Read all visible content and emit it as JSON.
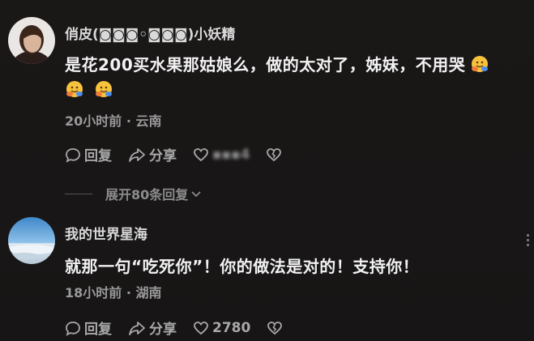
{
  "top_partial_text": "▂▂▂▂▂▂ ▂▂▂▂",
  "comments": [
    {
      "author": "俏皮(◙◙◙◦◙◙◙)小妖精",
      "text": "是花200买水果那姑娘么，做的太对了，姊妹，不用哭",
      "emoji_count": 3,
      "meta": "20小时前 · 云南",
      "reply_label": "回复",
      "share_label": "分享",
      "like_count": "▪▪▪4",
      "expand_label": "展开80条回复"
    },
    {
      "author": "我的世界星海",
      "text": "就那一句“吃死你”！你的做法是对的！支持你！",
      "meta": "18小时前 · 湖南",
      "reply_label": "回复",
      "share_label": "分享",
      "like_count": "2780"
    }
  ],
  "icons": {
    "reply": "speech-bubble-icon",
    "share": "share-arrow-icon",
    "like": "heart-icon",
    "dislike": "broken-heart-icon",
    "expand": "chevron-down-icon",
    "more": "more-vertical-icon",
    "emoji": "hugging-face-emoji"
  },
  "colors": {
    "background": "#181616",
    "text_primary": "#f2f2f2",
    "text_secondary": "#9a9a9a"
  }
}
